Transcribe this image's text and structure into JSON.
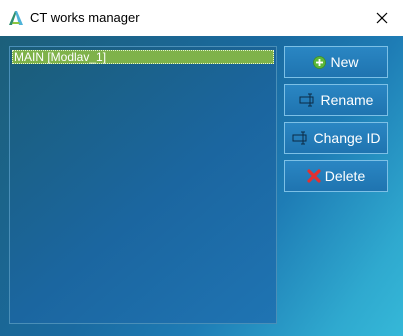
{
  "window": {
    "title": "CT works manager"
  },
  "list": {
    "items": [
      "MAIN [Modlav_1]"
    ]
  },
  "buttons": {
    "new_label": "New",
    "rename_label": "Rename",
    "change_id_label": "Change ID",
    "delete_label": "Delete"
  },
  "icons": {
    "app": "app-logo-icon",
    "close": "close-icon",
    "new": "plus-circle-icon",
    "rename": "rename-icon",
    "change_id": "rename-icon",
    "delete": "delete-x-icon"
  },
  "colors": {
    "background_dark": "#1c5f7a",
    "background_light": "#35b8d8",
    "selection": "#7fb24a",
    "button": "#2a86c3",
    "delete_red": "#e53030",
    "new_green": "#5cb83a"
  }
}
